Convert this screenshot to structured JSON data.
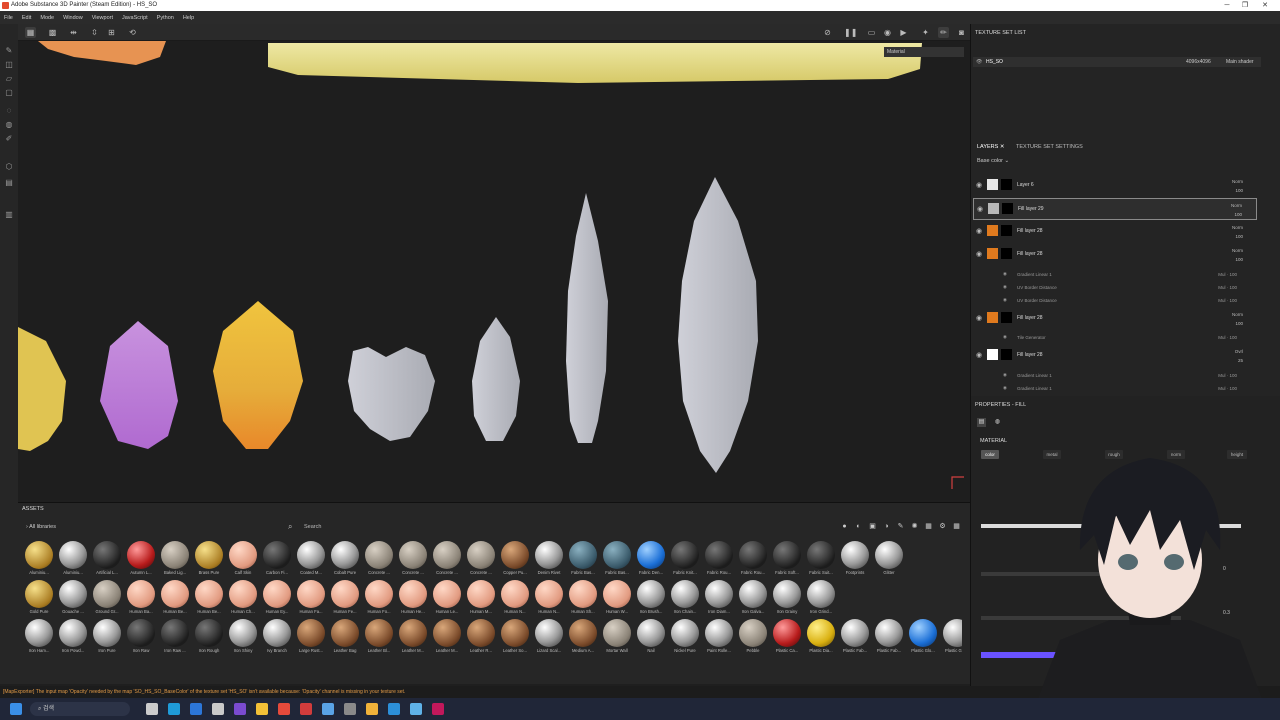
{
  "window": {
    "title": "Adobe Substance 3D Painter (Steam Edition) - HS_SO"
  },
  "menu": [
    "File",
    "Edit",
    "Mode",
    "Window",
    "Viewport",
    "JavaScript",
    "Python",
    "Help"
  ],
  "viewport": {
    "material_label": "Material"
  },
  "texture_set_list": {
    "title": "TEXTURE SET LIST",
    "row": {
      "name": "HS_SO",
      "resolution": "4096x4096",
      "shader": "Main shader"
    }
  },
  "layers": {
    "tab_layers": "LAYERS",
    "tab_settings": "TEXTURE SET SETTINGS",
    "channel": "Base color",
    "items": [
      {
        "name": "Layer 6",
        "blend": "Norm",
        "opacity": "100",
        "color": "#e8e8e8"
      },
      {
        "name": "Fill layer 29",
        "blend": "Norm",
        "opacity": "100",
        "color": "#b8b8b8"
      },
      {
        "name": "Fill layer 28",
        "blend": "Norm",
        "opacity": "100",
        "color": "#e07a1e"
      },
      {
        "name": "Fill layer 28",
        "blend": "Norm",
        "opacity": "100",
        "color": "#e07a1e"
      }
    ],
    "effects_a": [
      {
        "name": "Gradient Linear 1",
        "blend": "Mul",
        "opacity": "100"
      },
      {
        "name": "UV Border Distance",
        "blend": "Mul",
        "opacity": "100"
      },
      {
        "name": "UV Border Distance",
        "blend": "Mul",
        "opacity": "100"
      }
    ],
    "item_b": {
      "name": "Fill layer 28",
      "blend": "Norm",
      "opacity": "100",
      "color": "#e07a1e"
    },
    "effect_b": {
      "name": "Tile Generator",
      "blend": "Mul",
      "opacity": "100"
    },
    "item_c": {
      "name": "Fill layer 28",
      "blend": "Ovrl",
      "opacity": "25",
      "color": "#ffffff"
    },
    "effects_c": [
      {
        "name": "Gradient Linear 1",
        "blend": "Mul",
        "opacity": "100"
      },
      {
        "name": "Gradient Linear 1",
        "blend": "Mul",
        "opacity": "100"
      }
    ]
  },
  "properties": {
    "title": "PROPERTIES - FILL",
    "section": "MATERIAL",
    "channels": [
      "color",
      "metal",
      "rough",
      "norm",
      "height"
    ],
    "value_a": "0",
    "value_b": "0.3"
  },
  "assets": {
    "title": "ASSETS",
    "library": "All libraries",
    "search_placeholder": "Search",
    "row1": [
      "Aluminiu...",
      "Aluminiu...",
      "Artificial L...",
      "Autumn L...",
      "Baked Lig...",
      "Brass Pure",
      "Calf Skin",
      "Carbon Fi...",
      "Coated M...",
      "Cobalt Pure",
      "Concrete ...",
      "Concrete ...",
      "Concrete ...",
      "Concrete ...",
      "Copper Pu...",
      "Denim Rivet",
      "Fabric Bas...",
      "Fabric Bas...",
      "Fabric Den...",
      "Fabric Knit...",
      "Fabric Rou...",
      "Fabric Rou...",
      "Fabric Soft...",
      "Fabric Suit...",
      "Footprints",
      "Glitter"
    ],
    "row2": [
      "Gold Pure",
      "Gouache ...",
      "Ground Gr...",
      "Human Ba...",
      "Human Be...",
      "Human Be...",
      "Human Ch...",
      "Human Ey...",
      "Human Fa...",
      "Human Fe...",
      "Human Fo...",
      "Human He...",
      "Human Le...",
      "Human M...",
      "Human N...",
      "Human N...",
      "Human Sh...",
      "Human W...",
      "Iron Brush...",
      "Iron Chain...",
      "Iron Diam...",
      "Iron Galva...",
      "Iron Grainy",
      "Iron Grind..."
    ],
    "row3": [
      "Iron Ham...",
      "Iron Powd...",
      "Iron Pure",
      "Iron Raw",
      "Iron Raw ...",
      "Iron Rough",
      "Iron Shiny",
      "Ivy Branch",
      "Large Rust...",
      "Leather Bag",
      "Leather Bl...",
      "Leather M...",
      "Leather M...",
      "Leather R...",
      "Leather So...",
      "Lizard Scal...",
      "Medium A...",
      "Mortar Wall",
      "Nail",
      "Nickel Pure",
      "Paint Rolle...",
      "Pebble",
      "Plastic Ca...",
      "Plastic Dia...",
      "Plastic Fab...",
      "Plastic Fab...",
      "Plastic Glo...",
      "Plastic Gra..."
    ]
  },
  "status": {
    "message": "[MapExporter] The input map 'Opacity' needed by the map 'SO_HS_SO_BaseColor' of the texture set 'HS_SO' isn't available because: 'Opacity' channel is missing in your texture set."
  },
  "taskbar": {
    "search": "검색"
  }
}
